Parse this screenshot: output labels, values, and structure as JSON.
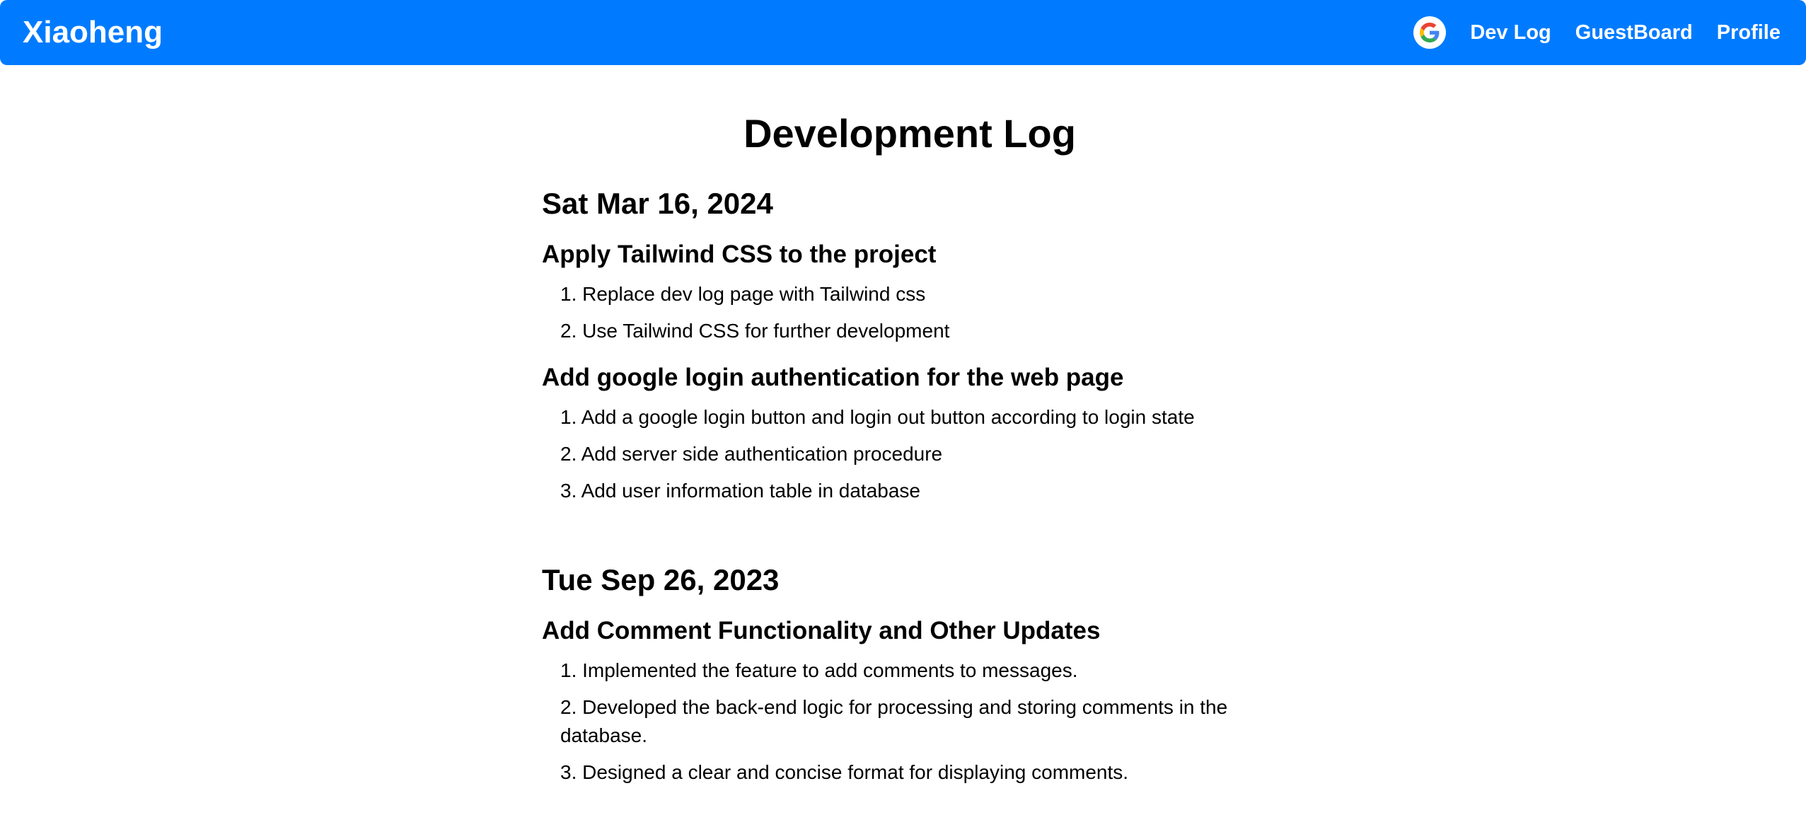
{
  "navbar": {
    "brand": "Xiaoheng",
    "google_icon": "google-logo-icon",
    "links": [
      {
        "label": "Dev Log"
      },
      {
        "label": "GuestBoard"
      },
      {
        "label": "Profile"
      }
    ],
    "background_color": "#007bff"
  },
  "main": {
    "title": "Development Log",
    "entries": [
      {
        "date": "Sat Mar 16, 2024",
        "tasks": [
          {
            "title": "Apply Tailwind CSS to the project",
            "items": [
              "1. Replace dev log page with Tailwind css",
              "2. Use Tailwind CSS for further development"
            ]
          },
          {
            "title": "Add google login authentication for the web page",
            "items": [
              "1. Add a google login button and login out button according to login state",
              "2. Add server side authentication procedure",
              "3. Add user information table in database"
            ]
          }
        ]
      },
      {
        "date": "Tue Sep 26, 2023",
        "tasks": [
          {
            "title": "Add Comment Functionality and Other Updates",
            "items": [
              "1. Implemented the feature to add comments to messages.",
              "2. Developed the back-end logic for processing and storing comments in the database.",
              "3. Designed a clear and concise format for displaying comments."
            ]
          }
        ]
      }
    ]
  }
}
